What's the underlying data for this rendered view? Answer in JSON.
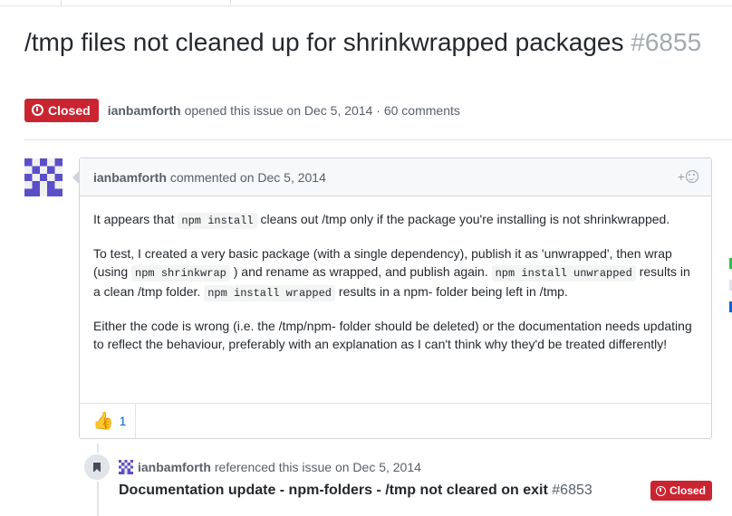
{
  "issue": {
    "title": "/tmp files not cleaned up for shrinkwrapped packages",
    "number": "#6855",
    "state": "Closed",
    "author": "ianbamforth",
    "meta_text": "opened this issue on Dec 5, 2014 · 60 comments"
  },
  "comment": {
    "author": "ianbamforth",
    "meta_text": "commented on Dec 5, 2014",
    "add_reaction": "+",
    "p1_a": "It appears that ",
    "p1_code": "npm install",
    "p1_b": " cleans out /tmp only if the package you're installing is not shrinkwrapped.",
    "p2_a": "To test, I created a very basic package (with a single dependency), publish it as 'unwrapped', then wrap (using ",
    "p2_code1": "npm shrinkwrap",
    "p2_b": " ) and rename as wrapped, and publish again. ",
    "p2_code2": "npm install unwrapped",
    "p2_c": " results in a clean /tmp folder. ",
    "p2_code3": "npm install wrapped",
    "p2_d": " results in a npm- folder being left in /tmp.",
    "p3": "Either the code is wrong (i.e. the /tmp/npm- folder should be deleted) or the documentation needs updating to reflect the behaviour, preferably with an explanation as I can't think why they'd be treated differently!",
    "reaction_icon": "👍",
    "reaction_count": "1"
  },
  "reference": {
    "author": "ianbamforth",
    "meta_text": "referenced this issue on Dec 5, 2014",
    "title": "Documentation update - npm-folders - /tmp not cleared on exit",
    "number": "#6853",
    "state": "Closed"
  },
  "colors": {
    "closed": "#cb2431",
    "avatar": "#5b4fc9",
    "link": "#0366d6"
  }
}
